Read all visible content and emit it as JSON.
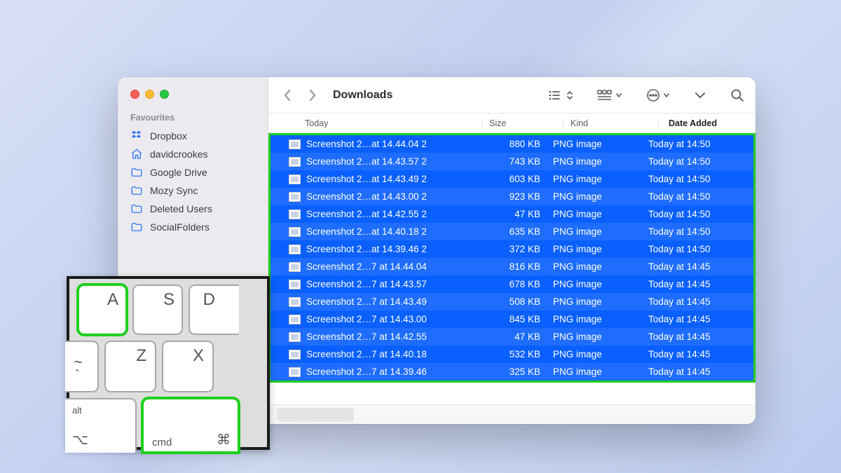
{
  "window": {
    "title": "Downloads"
  },
  "sidebar": {
    "section": "Favourites",
    "items": [
      {
        "label": "Dropbox",
        "icon": "dropbox"
      },
      {
        "label": "davidcrookes",
        "icon": "home"
      },
      {
        "label": "Google Drive",
        "icon": "folder"
      },
      {
        "label": "Mozy Sync",
        "icon": "folder"
      },
      {
        "label": "Deleted Users",
        "icon": "folder"
      },
      {
        "label": "SocialFolders",
        "icon": "folder"
      }
    ]
  },
  "columns": {
    "c1": "Today",
    "c2": "Size",
    "c3": "Kind",
    "c4": "Date Added"
  },
  "files": [
    {
      "name": "Screenshot 2…at 14.44.04 2",
      "size": "880 KB",
      "kind": "PNG image",
      "date": "Today at 14:50"
    },
    {
      "name": "Screenshot 2…at 14.43.57 2",
      "size": "743 KB",
      "kind": "PNG image",
      "date": "Today at 14:50"
    },
    {
      "name": "Screenshot 2…at 14.43.49 2",
      "size": "603 KB",
      "kind": "PNG image",
      "date": "Today at 14:50"
    },
    {
      "name": "Screenshot 2…at 14.43.00 2",
      "size": "923 KB",
      "kind": "PNG image",
      "date": "Today at 14:50"
    },
    {
      "name": "Screenshot 2…at 14.42.55 2",
      "size": "47 KB",
      "kind": "PNG image",
      "date": "Today at 14:50"
    },
    {
      "name": "Screenshot 2…at 14.40.18 2",
      "size": "635 KB",
      "kind": "PNG image",
      "date": "Today at 14:50"
    },
    {
      "name": "Screenshot 2…at 14.39.46 2",
      "size": "372 KB",
      "kind": "PNG image",
      "date": "Today at 14:50"
    },
    {
      "name": "Screenshot 2…7 at 14.44.04",
      "size": "816 KB",
      "kind": "PNG image",
      "date": "Today at 14:45"
    },
    {
      "name": "Screenshot 2…7 at 14.43.57",
      "size": "678 KB",
      "kind": "PNG image",
      "date": "Today at 14:45"
    },
    {
      "name": "Screenshot 2…7 at 14.43.49",
      "size": "508 KB",
      "kind": "PNG image",
      "date": "Today at 14:45"
    },
    {
      "name": "Screenshot 2…7 at 14.43.00",
      "size": "845 KB",
      "kind": "PNG image",
      "date": "Today at 14:45"
    },
    {
      "name": "Screenshot 2…7 at 14.42.55",
      "size": "47 KB",
      "kind": "PNG image",
      "date": "Today at 14:45"
    },
    {
      "name": "Screenshot 2…7 at 14.40.18",
      "size": "532 KB",
      "kind": "PNG image",
      "date": "Today at 14:45"
    },
    {
      "name": "Screenshot 2…7 at 14.39.46",
      "size": "325 KB",
      "kind": "PNG image",
      "date": "Today at 14:45"
    }
  ],
  "keyboard": {
    "A": "A",
    "S": "S",
    "D": "D",
    "Z": "Z",
    "X": "X",
    "tilde": "~",
    "backtick": "`",
    "alt": "alt",
    "altSym": "⌥",
    "cmd": "cmd",
    "cmdSym": "⌘"
  }
}
